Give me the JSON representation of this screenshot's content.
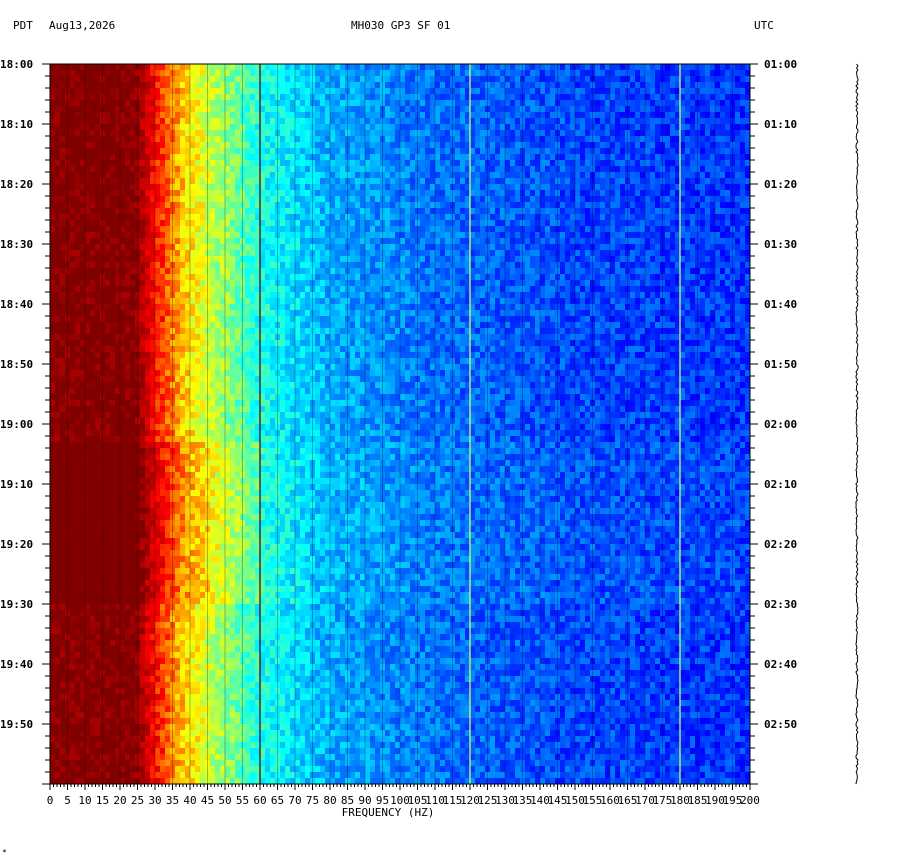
{
  "header": {
    "left_tz": "PDT",
    "date": "Aug13,2026",
    "station": "MH030 GP3 SF 01",
    "right_tz": "UTC"
  },
  "footer_mark": "*",
  "chart_data": {
    "type": "heatmap",
    "title": "MH030 GP3 SF 01",
    "xlabel": "FREQUENCY (HZ)",
    "xlim": [
      0,
      200
    ],
    "x_ticks": [
      0,
      5,
      10,
      15,
      20,
      25,
      30,
      35,
      40,
      45,
      50,
      55,
      60,
      65,
      70,
      75,
      80,
      85,
      90,
      95,
      100,
      105,
      110,
      115,
      120,
      125,
      130,
      135,
      140,
      145,
      150,
      155,
      160,
      165,
      170,
      175,
      180,
      185,
      190,
      195,
      200
    ],
    "left_time_labels": [
      "18:00",
      "18:10",
      "18:20",
      "18:30",
      "18:40",
      "18:50",
      "19:00",
      "19:10",
      "19:20",
      "19:30",
      "19:40",
      "19:50"
    ],
    "right_time_labels": [
      "01:00",
      "01:10",
      "01:20",
      "01:30",
      "01:40",
      "01:50",
      "02:00",
      "02:10",
      "02:20",
      "02:30",
      "02:40",
      "02:50"
    ],
    "duration_minutes": 120,
    "colormap": [
      "#800000",
      "#ff0000",
      "#ffff00",
      "#00ffff",
      "#0000ff"
    ],
    "spectrum_profile_hz": [
      0,
      24,
      30,
      38,
      48,
      60,
      80,
      110,
      150,
      200
    ],
    "spectrum_profile_level": [
      1.0,
      1.0,
      0.82,
      0.66,
      0.55,
      0.42,
      0.32,
      0.26,
      0.22,
      0.2
    ],
    "line_frequencies_hz": [
      60,
      120,
      180
    ],
    "grid_lines_every_hz": 5
  }
}
